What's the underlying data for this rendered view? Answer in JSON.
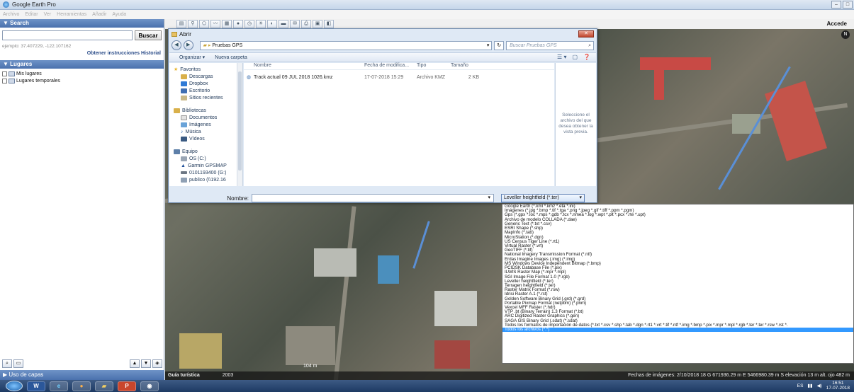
{
  "window": {
    "title": "Google Earth Pro",
    "menu": [
      "Archivo",
      "Editar",
      "Ver",
      "Herramientas",
      "Añadir",
      "Ayuda"
    ]
  },
  "left_panel": {
    "search_header": "▼ Search",
    "search_button": "Buscar",
    "search_example": "ejemplo: 37.407229, -122.107162",
    "directions_link": "Obtener instrucciones",
    "history_link": "Historial",
    "places_header": "▼ Lugares",
    "places": [
      "Mis lugares",
      "Lugares temporales"
    ],
    "layers_header": "▶ Uso de capas"
  },
  "toolbar": {
    "sign_in": "Accede"
  },
  "dialog": {
    "title": "Abrir",
    "address": "Pruebas GPS",
    "search_placeholder": "Buscar Pruebas GPS",
    "organize": "Organizar ▾",
    "new_folder": "Nueva carpeta",
    "nav": {
      "favorites_head": "Favoritos",
      "favorites": [
        "Descargas",
        "Dropbox",
        "Escritorio",
        "Sitios recientes"
      ],
      "libraries_head": "Bibliotecas",
      "libraries": [
        "Documentos",
        "Imágenes",
        "Música",
        "Vídeos"
      ],
      "computer_head": "Equipo",
      "computer": [
        "OS (C:)",
        "Garmin GPSMAP",
        "0101193400 (G:)",
        "publico (\\\\192.16"
      ]
    },
    "columns": [
      "Nombre",
      "Fecha de modifica...",
      "Tipo",
      "Tamaño"
    ],
    "files": [
      {
        "name": "Track actual 09 JUL 2018 1026.kmz",
        "date": "17-07-2018 15:29",
        "type": "Archivo KMZ",
        "size": "2 KB"
      }
    ],
    "preview_text": "Seleccione el archivo del que desea obtener la vista previa.",
    "name_label": "Nombre:",
    "filetype_selected": "Leveller heightfield (*.ter)",
    "filetype_options": [
      "Google Earth (*.kml *.kmz *.eta *.ini)",
      "Imágenes (*.jpg *.bmp *.tif *.tga *.png *.jpeg *.gif *.tiff *.ppm *.pgm)",
      "Gps (*.gpx *.loc *.mps *.gdb *.tcx *.nmea *.log *.wpt *.plt *.pcx *.rte *.upt)",
      "Archivo de modelo COLLADA (*.dae)",
      "Generic Text (*.txt *.csv)",
      "ESRI Shape (*.shp)",
      "MapInfo (*.tab)",
      "MicroStation (*.dgn)",
      "US Census Tiger Line (*.rt1)",
      "Virtual Raster (*.vrt)",
      "GeoTIFF (*.tif)",
      "National Imagery Transmission Format (*.ntf)",
      "Erdas Imagine Images (.img) (*.img)",
      "MS Windows Device Independent Bitmap (*.bmp)",
      "PCIDSK Database File (*.pix)",
      "ILWIS Raster Map (*.mpr *.mpl)",
      "SGI Image File Format 1.0 (*.rgb)",
      "Leveller heightfield (*.ter)",
      "Terragen heightfield (*.ter)",
      "Raster Matrix Format (*.rsw)",
      "Idrisi Raster A.1 (*.rst)",
      "Golden Software Binary Grid (.grd) (*.grd)",
      "Portable Pixmap Format (netpbm) (*.pnm)",
      "Vexcel MFF Raster (*.hdr)",
      "VTP .bt (Binary Terrain) 1.3 Format (*.bt)",
      "ARC Digitized Raster Graphics (*.gen)",
      "SAGA GIS Binary Grid (.sdat) (*.sdat)",
      "Todos los formatos de importación de datos (*.txt *.csv *.shp *.tab *.dgn *.rt1 *.vrt *.tif *.ntf *.img *.bmp *.pix *.mpr *.mpl *.rgb *.ter *.ter *.rsw *.rst *.",
      "Todos los archivos (*.*)"
    ]
  },
  "map": {
    "tour_label": "Guía turística",
    "year_label": "2003",
    "scale_label": "104 m",
    "status": "Fechas de imágenes: 2/10/2018    18 G 671936.29 m E 5466980.39 m S elevación   13 m    alt. ojo   482 m"
  },
  "taskbar": {
    "clock_time": "16:51",
    "clock_date": "17-07-2018"
  }
}
